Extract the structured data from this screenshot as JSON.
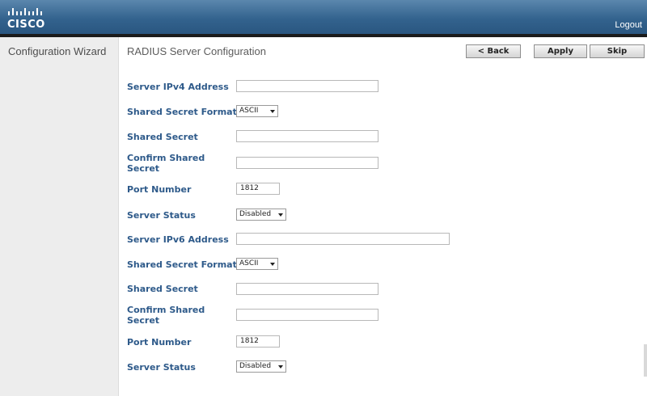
{
  "header": {
    "logo_text": "CISCO",
    "logout_label": "Logout"
  },
  "sidebar": {
    "title": "Configuration Wizard"
  },
  "main": {
    "title": "RADIUS Server Configuration",
    "buttons": {
      "back": "< Back",
      "apply": "Apply",
      "skip": "Skip"
    },
    "ipv4": {
      "address_label": "Server IPv4 Address",
      "address_value": "",
      "secret_format_label": "Shared Secret Format",
      "secret_format_value": "ASCII",
      "secret_label": "Shared Secret",
      "confirm_label_line1": "Confirm Shared",
      "confirm_label_line2": "Secret",
      "port_label": "Port Number",
      "port_value": "1812",
      "status_label": "Server Status",
      "status_value": "Disabled"
    },
    "ipv6": {
      "address_label": "Server IPv6 Address",
      "address_value": "",
      "secret_format_label": "Shared Secret Format",
      "secret_format_value": "ASCII",
      "secret_label": "Shared Secret",
      "confirm_label_line1": "Confirm Shared",
      "confirm_label_line2": "Secret",
      "port_label": "Port Number",
      "port_value": "1812",
      "status_label": "Server Status",
      "status_value": "Disabled"
    }
  },
  "colors": {
    "header": "#33638e",
    "label": "#2e5a8a",
    "sidebar": "#ededed"
  }
}
